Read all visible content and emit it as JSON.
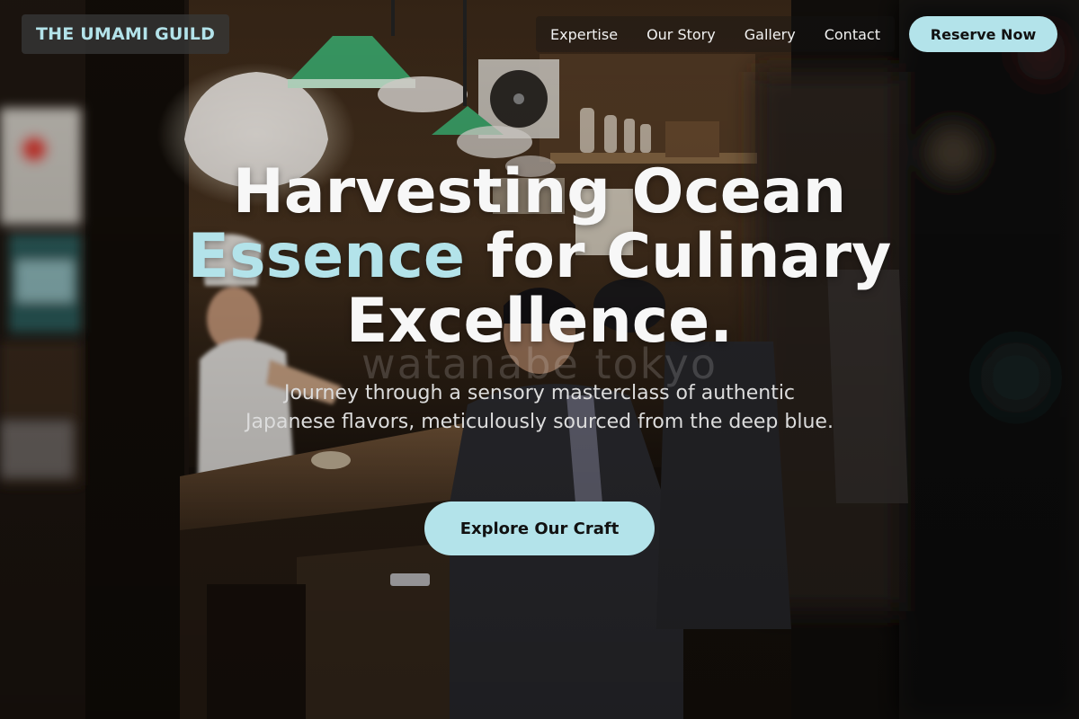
{
  "nav": {
    "logo": "THE UMAMI GUILD",
    "links": [
      "Expertise",
      "Our Story",
      "Gallery",
      "Contact"
    ],
    "reserve_label": "Reserve Now"
  },
  "hero": {
    "headline_line1": "Harvesting Ocean",
    "headline_accent": "Essence",
    "headline_line2_rest": " for Culinary",
    "headline_line3": "Excellence.",
    "watermark": "watanabe tokyo",
    "subtitle": "Journey through a sensory masterclass of authentic Japanese flavors, meticulously sourced from the deep blue.",
    "cta_label": "Explore Our Craft"
  },
  "colors": {
    "accent": "#b3e3ea",
    "headline": "#f7f7f7",
    "button_text": "#111111"
  }
}
